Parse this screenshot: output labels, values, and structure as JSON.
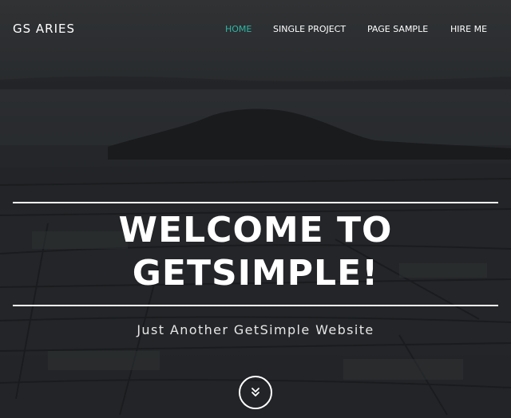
{
  "header": {
    "brand": "GS ARIES",
    "nav": [
      {
        "label": "HOME",
        "active": true
      },
      {
        "label": "SINGLE PROJECT",
        "active": false
      },
      {
        "label": "PAGE SAMPLE",
        "active": false
      },
      {
        "label": "HIRE ME",
        "active": false
      }
    ],
    "active_color": "#2fb5a5"
  },
  "hero": {
    "headline_line1": "WELCOME TO",
    "headline_line2": "GETSIMPLE!",
    "tagline": "Just Another GetSimple Website",
    "scroll_icon": "double-chevron-down-icon"
  }
}
